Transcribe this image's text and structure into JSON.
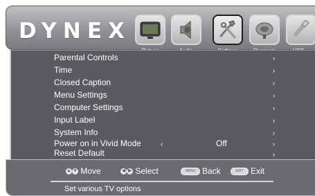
{
  "brand": "DYNEX",
  "tabs": [
    {
      "label": "Picture",
      "icon": "tv-icon"
    },
    {
      "label": "Audio",
      "icon": "speaker-icon"
    },
    {
      "label": "Settings",
      "icon": "tools-icon",
      "active": true
    },
    {
      "label": "Channels",
      "icon": "satellite-dish-icon"
    },
    {
      "label": "USB",
      "icon": "usb-icon"
    }
  ],
  "menu": {
    "items": [
      {
        "label": "Parental Controls"
      },
      {
        "label": "Time"
      },
      {
        "label": "Closed Caption"
      },
      {
        "label": "Menu Settings"
      },
      {
        "label": "Computer Settings"
      },
      {
        "label": "Input Label"
      },
      {
        "label": "System Info"
      },
      {
        "label": "Power on in Vivid Mode",
        "value": "Off"
      },
      {
        "label": "Reset Default"
      }
    ],
    "chevron": "›",
    "left_chevron": "‹"
  },
  "footer": {
    "move_label": "Move",
    "select_label": "Select",
    "back_label": "Back",
    "exit_label": "Exit",
    "menu_key": "MENU",
    "exit_key": "EXIT",
    "status_text": "Set various TV options"
  }
}
